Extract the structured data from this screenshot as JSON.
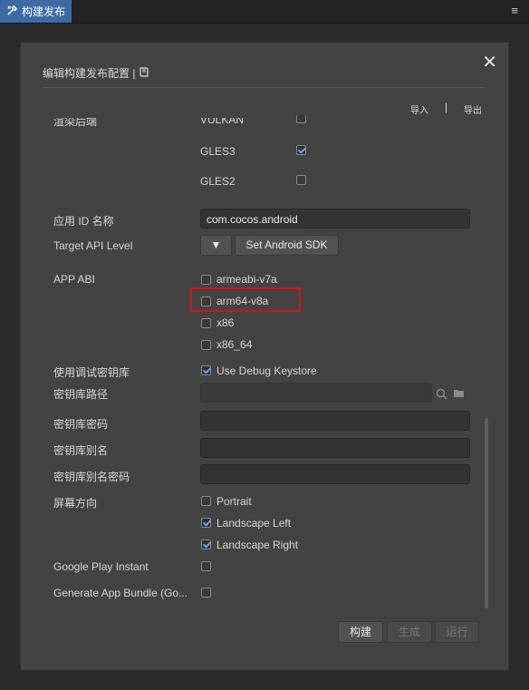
{
  "panel": {
    "tab_label": "构建发布",
    "menu_icon": "hamburger-icon"
  },
  "dialog": {
    "title": "编辑构建发布配置 |",
    "import_label": "导入",
    "divider": "|",
    "export_label": "导出",
    "render_backend_label": "渲染后端",
    "render_backends": [
      {
        "label": "VULKAN",
        "checked": false
      },
      {
        "label": "GLES3",
        "checked": true
      },
      {
        "label": "GLES2",
        "checked": false
      }
    ],
    "app_id_label": "应用 ID 名称",
    "app_id_value": "com.cocos.android",
    "target_api_label": "Target API Level",
    "target_api_dropdown": "▼",
    "set_sdk_button": "Set Android SDK",
    "app_abi_label": "APP ABI",
    "abis": [
      {
        "label": "armeabi-v7a",
        "checked": false
      },
      {
        "label": "arm64-v8a",
        "checked": false
      },
      {
        "label": "x86",
        "checked": false
      },
      {
        "label": "x86_64",
        "checked": false
      }
    ],
    "debug_keystore_label": "使用调试密钥库",
    "debug_keystore_option": "Use Debug Keystore",
    "debug_keystore_checked": true,
    "keystore_path_label": "密钥库路径",
    "keystore_password_label": "密钥库密码",
    "keystore_alias_label": "密钥库别名",
    "keystore_alias_password_label": "密钥库别名密码",
    "orientation_label": "屏幕方向",
    "orientations": [
      {
        "label": "Portrait",
        "checked": false
      },
      {
        "label": "Landscape Left",
        "checked": true
      },
      {
        "label": "Landscape Right",
        "checked": true
      }
    ],
    "google_play_instant_label": "Google Play Instant",
    "google_play_instant_checked": false,
    "app_bundle_label": "Generate App Bundle (Go...",
    "app_bundle_checked": false,
    "build_button": "构建",
    "make_button": "生成",
    "run_button": "运行"
  }
}
